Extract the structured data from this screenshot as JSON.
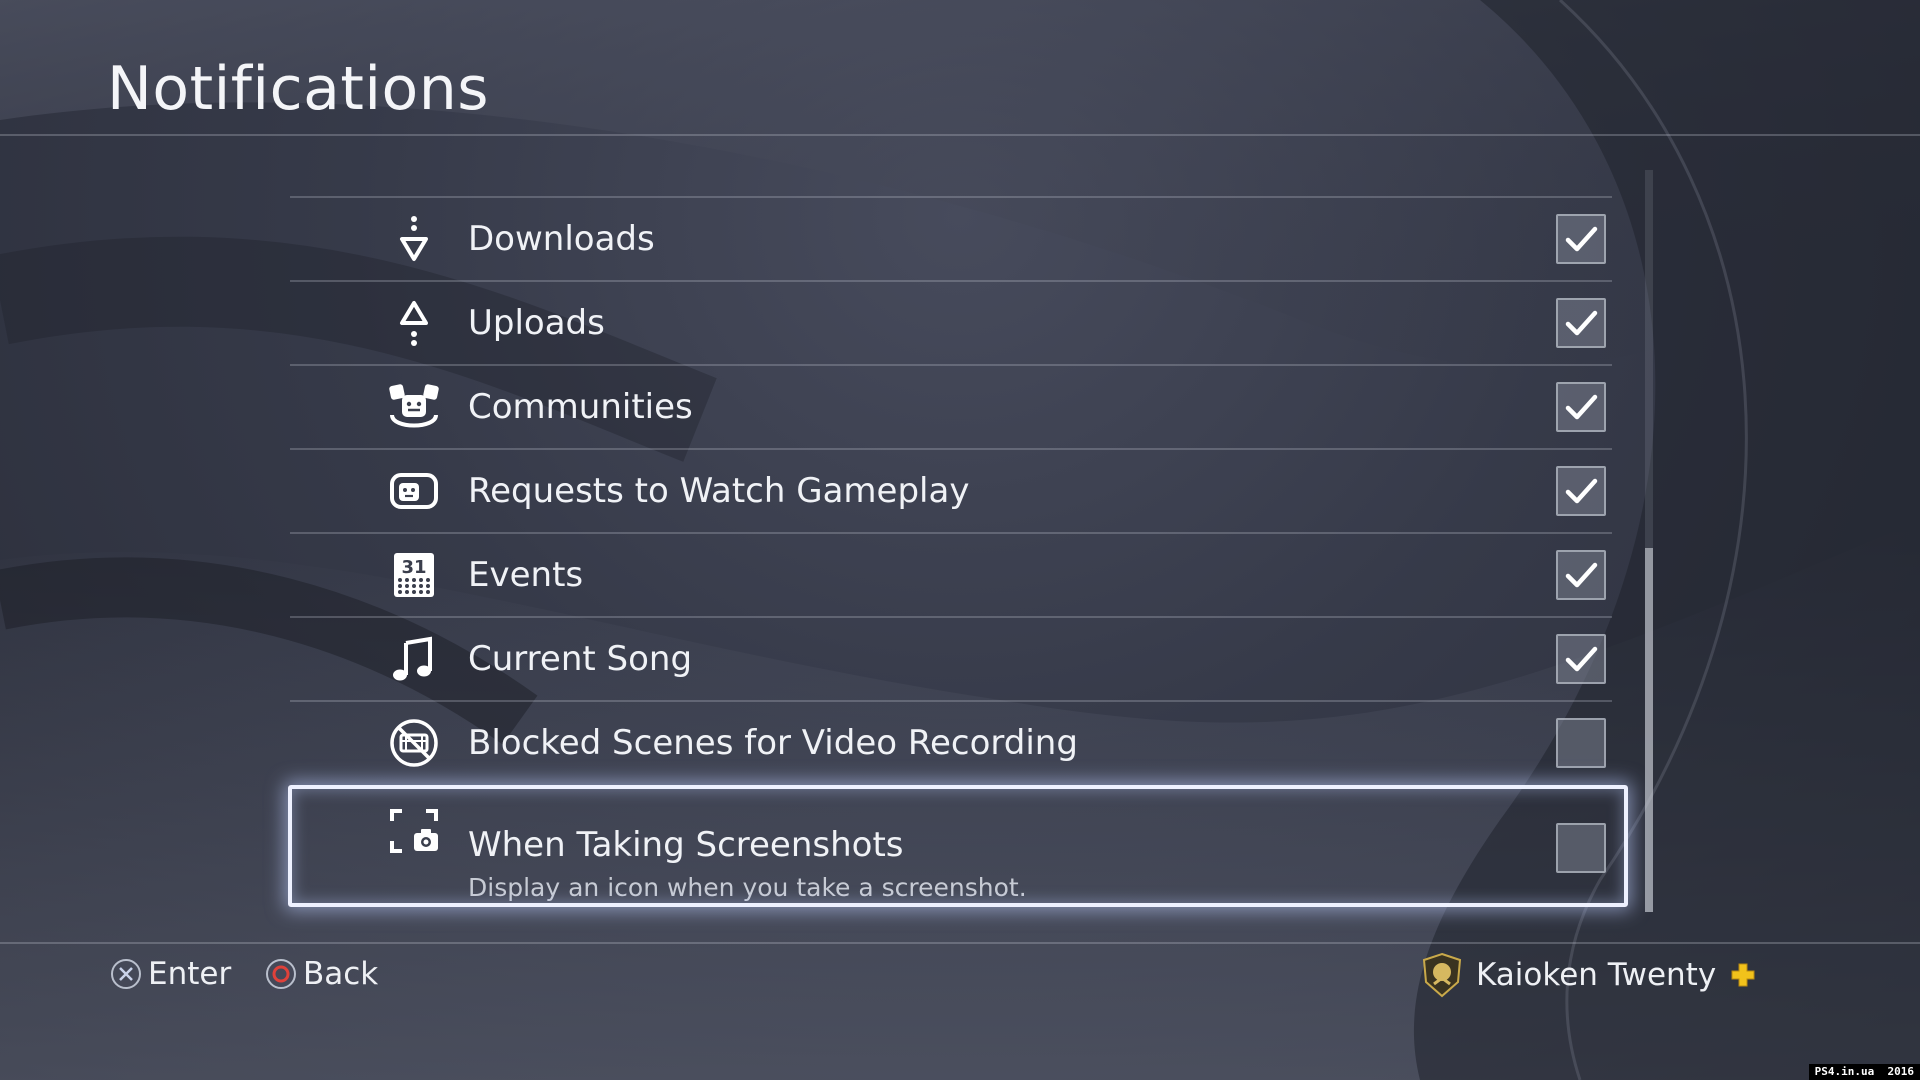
{
  "page": {
    "title": "Notifications"
  },
  "settings": [
    {
      "label": "Downloads",
      "icon": "download-icon",
      "checked": true
    },
    {
      "label": "Uploads",
      "icon": "upload-icon",
      "checked": true
    },
    {
      "label": "Communities",
      "icon": "communities-icon",
      "checked": true
    },
    {
      "label": "Requests to Watch Gameplay",
      "icon": "watch-gameplay-icon",
      "checked": true
    },
    {
      "label": "Events",
      "icon": "calendar-icon",
      "checked": true
    },
    {
      "label": "Current Song",
      "icon": "music-note-icon",
      "checked": true
    },
    {
      "label": "Blocked Scenes for Video Recording",
      "icon": "blocked-video-icon",
      "checked": false
    },
    {
      "label": "When Taking Screenshots",
      "sublabel": "Display an icon when you take a screenshot.",
      "icon": "screenshot-camera-icon",
      "checked": false,
      "focused": true
    }
  ],
  "calendar_day": "31",
  "footer": {
    "enter_label": "Enter",
    "back_label": "Back",
    "user_name": "Kaioken Twenty",
    "enter_icon": "cross-button-icon",
    "back_icon": "circle-button-icon",
    "plus_icon": "playstation-plus-icon"
  },
  "watermark": "PS4.in.ua  2016",
  "colors": {
    "accent_plus": "#f2c21b",
    "circle_button": "#e0413a",
    "focus_glow": "#eef1ff"
  }
}
